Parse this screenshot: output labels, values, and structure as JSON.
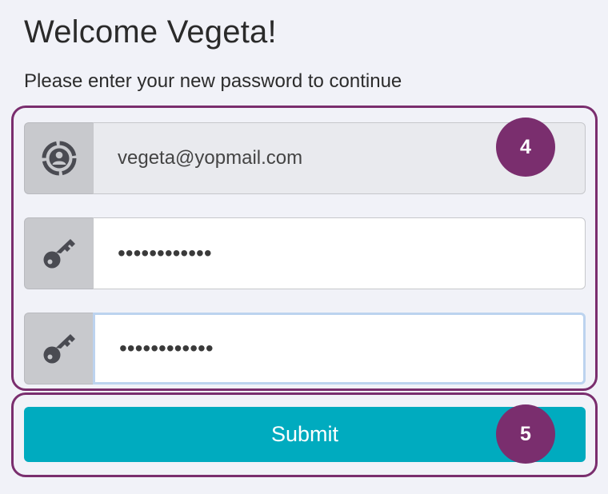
{
  "header": {
    "title": "Welcome Vegeta!",
    "subtitle": "Please enter your new password to continue"
  },
  "form": {
    "email": {
      "value": "vegeta@yopmail.com",
      "icon": "user-circle-icon",
      "readonly": true
    },
    "new_password": {
      "value": "••••••••••••",
      "icon": "key-icon"
    },
    "confirm_password": {
      "value": "••••••••••••",
      "icon": "key-icon",
      "focused": true
    },
    "submit_label": "Submit"
  },
  "annotations": {
    "fields_step": "4",
    "submit_step": "5"
  },
  "colors": {
    "background": "#f1f2f8",
    "accent": "#00abbf",
    "highlight": "#7a2e6e",
    "icon_bg": "#c8c9cd",
    "icon": "#4a4b52"
  }
}
